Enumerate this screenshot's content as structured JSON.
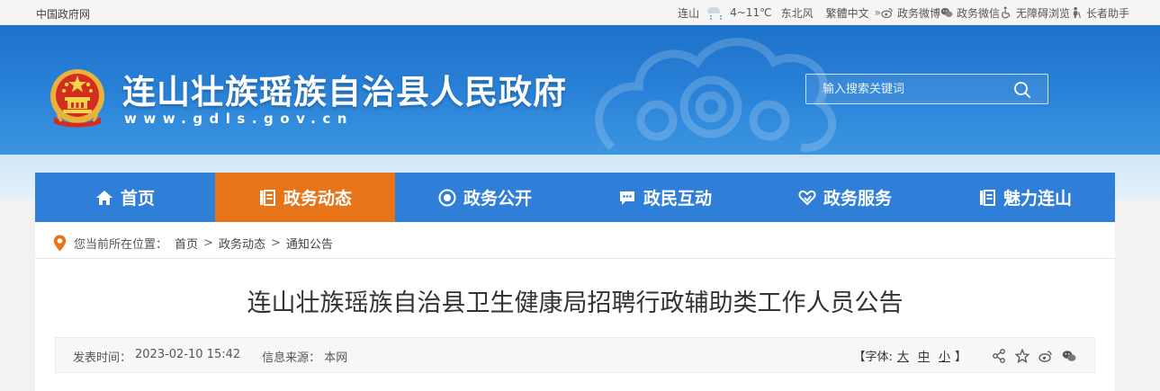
{
  "topbar": {
    "gov_link": "中国政府网",
    "weather": {
      "city": "连山",
      "temp": "4~11℃",
      "wind": "东北风"
    },
    "links": {
      "traditional": "繁體中文",
      "weibo": "政务微博",
      "wechat": "政务微信",
      "accessible": "无障碍浏览",
      "elder": "长者助手"
    }
  },
  "header": {
    "title": "连山壮族瑶族自治县人民政府",
    "url": "www.gdls.gov.cn",
    "search": {
      "placeholder": "输入搜索关键词"
    }
  },
  "nav": {
    "items": [
      {
        "label": "首页",
        "icon": "home-icon",
        "active": false
      },
      {
        "label": "政务动态",
        "icon": "list-icon",
        "active": true
      },
      {
        "label": "政务公开",
        "icon": "eye-icon",
        "active": false
      },
      {
        "label": "政民互动",
        "icon": "chat-icon",
        "active": false
      },
      {
        "label": "政务服务",
        "icon": "heart-hand-icon",
        "active": false
      },
      {
        "label": "魅力连山",
        "icon": "book-icon",
        "active": false
      }
    ]
  },
  "breadcrumb": {
    "prefix": "您当前所在位置：",
    "items": [
      "首页",
      "政务动态",
      "通知公告"
    ],
    "separator": ">"
  },
  "article": {
    "title": "连山壮族瑶族自治县卫生健康局招聘行政辅助类工作人员公告",
    "publish_label": "发表时间：",
    "publish_time": "2023-02-10 15:42",
    "source_label": "信息来源：",
    "source": "本网",
    "font_label_open": "【字体:",
    "font_large": "大",
    "font_medium": "中",
    "font_small": "小",
    "font_label_close": "】"
  },
  "colors": {
    "nav_bg": "#2f7fd8",
    "nav_active": "#e8741a",
    "banner": "#1d71c9"
  }
}
